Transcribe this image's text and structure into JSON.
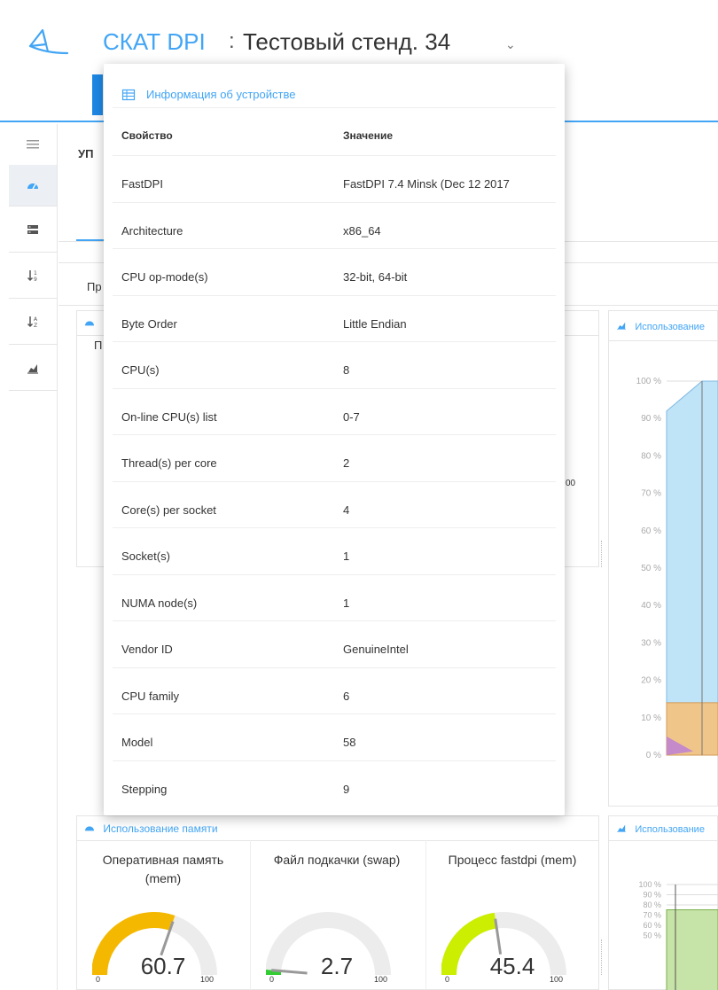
{
  "header": {
    "brand": "СКАТ DPI",
    "separator": ":",
    "device_title": "Тестовый стенд. 34",
    "caret": "⌄"
  },
  "background": {
    "page_heading_fragment": "УП",
    "tab_fragment": "Пр",
    "gauge_panel_fragment": "П",
    "tick_fragment": "00",
    "cpu_chart_title": "Использование",
    "cpu_chart_yticks": [
      "100 %",
      "90 %",
      "80 %",
      "70 %",
      "60 %",
      "50 %",
      "40 %",
      "30 %",
      "20 %",
      "10 %",
      "0 %"
    ],
    "memory_panel_title": "Использование памяти",
    "memory_chart_title": "Использование",
    "memory_chart_yticks": [
      "100 %",
      "90 %",
      "80 %",
      "70 %",
      "60 %",
      "50 %"
    ]
  },
  "gauges": [
    {
      "title": "Оперативная память (mem)",
      "value": "60.7",
      "fraction": 0.607,
      "color": "#f5b800",
      "min": "0",
      "max": "100"
    },
    {
      "title": "Файл подкачки (swap)",
      "value": "2.7",
      "fraction": 0.027,
      "color": "#33cc33",
      "min": "0",
      "max": "100"
    },
    {
      "title": "Процесс fastdpi (mem)",
      "value": "45.4",
      "fraction": 0.454,
      "color": "#ccee00",
      "min": "0",
      "max": "100"
    }
  ],
  "device_info": {
    "title": "Информация об устройстве",
    "col_property": "Свойство",
    "col_value": "Значение",
    "rows": [
      {
        "property": "FastDPI",
        "value": "FastDPI 7.4 Minsk (Dec 12 2017"
      },
      {
        "property": "Architecture",
        "value": "x86_64"
      },
      {
        "property": "CPU op-mode(s)",
        "value": "32-bit, 64-bit"
      },
      {
        "property": "Byte Order",
        "value": "Little Endian"
      },
      {
        "property": "CPU(s)",
        "value": "8"
      },
      {
        "property": "On-line CPU(s) list",
        "value": "0-7"
      },
      {
        "property": "Thread(s) per core",
        "value": "2"
      },
      {
        "property": "Core(s) per socket",
        "value": "4"
      },
      {
        "property": "Socket(s)",
        "value": "1"
      },
      {
        "property": "NUMA node(s)",
        "value": "1"
      },
      {
        "property": "Vendor ID",
        "value": "GenuineIntel"
      },
      {
        "property": "CPU family",
        "value": "6"
      },
      {
        "property": "Model",
        "value": "58"
      },
      {
        "property": "Stepping",
        "value": "9"
      }
    ]
  },
  "colors": {
    "accent": "#42a5f5",
    "cpu_area": "#bfe3f7",
    "cpu_area_2": "#f0c58a",
    "cpu_area_3": "#c58ac9",
    "mem_area": "#c6e3a8"
  }
}
